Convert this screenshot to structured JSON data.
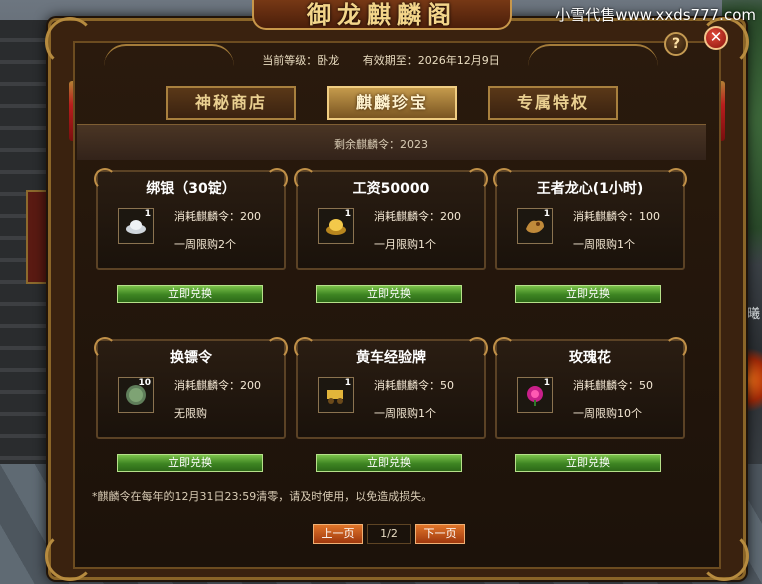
{
  "watermark": "小雪代售www.xxds777.com",
  "side_text": "晨曦",
  "window": {
    "title": "御龙麒麟阁",
    "help_label": "?",
    "close_label": "✕"
  },
  "info": {
    "level": "当前等级：卧龙",
    "expiry": "有效期至：2026年12月9日"
  },
  "tabs": [
    {
      "label": "神秘商店",
      "active": false
    },
    {
      "label": "麒麟珍宝",
      "active": true
    },
    {
      "label": "专属特权",
      "active": false
    }
  ],
  "remaining": "剩余麒麟令：2023",
  "items": [
    {
      "title": "绑银（30锭）",
      "qty": "1",
      "cost_label": "消耗麒麟令：",
      "cost": "200",
      "limit": "一周限购2个",
      "icon": "silver-ingot-icon",
      "button": "立即兑换"
    },
    {
      "title": "工资50000",
      "qty": "1",
      "cost_label": "消耗麒麟令：",
      "cost": "200",
      "limit": "一月限购1个",
      "icon": "gold-ingot-icon",
      "button": "立即兑换"
    },
    {
      "title": "王者龙心(1小时)",
      "qty": "1",
      "cost_label": "消耗麒麟令：",
      "cost": "100",
      "limit": "一周限购1个",
      "icon": "dragon-heart-icon",
      "button": "立即兑换"
    },
    {
      "title": "换镖令",
      "qty": "10",
      "cost_label": "消耗麒麟令：",
      "cost": "200",
      "limit": "无限购",
      "icon": "escort-token-icon",
      "button": "立即兑换"
    },
    {
      "title": "黄车经验牌",
      "qty": "1",
      "cost_label": "消耗麒麟令：",
      "cost": "50",
      "limit": "一周限购1个",
      "icon": "gold-cart-icon",
      "button": "立即兑换"
    },
    {
      "title": "玫瑰花",
      "qty": "1",
      "cost_label": "消耗麒麟令：",
      "cost": "50",
      "limit": "一周限购10个",
      "icon": "rose-icon",
      "button": "立即兑换"
    }
  ],
  "footnote": "*麒麟令在每年的12月31日23:59清零，请及时使用，以免造成损失。",
  "pager": {
    "prev": "上一页",
    "page": "1/2",
    "next": "下一页"
  },
  "colors": {
    "accent_gold": "#c8974a",
    "redeem_green": "#3d8422",
    "pager_orange": "#a0380e"
  }
}
